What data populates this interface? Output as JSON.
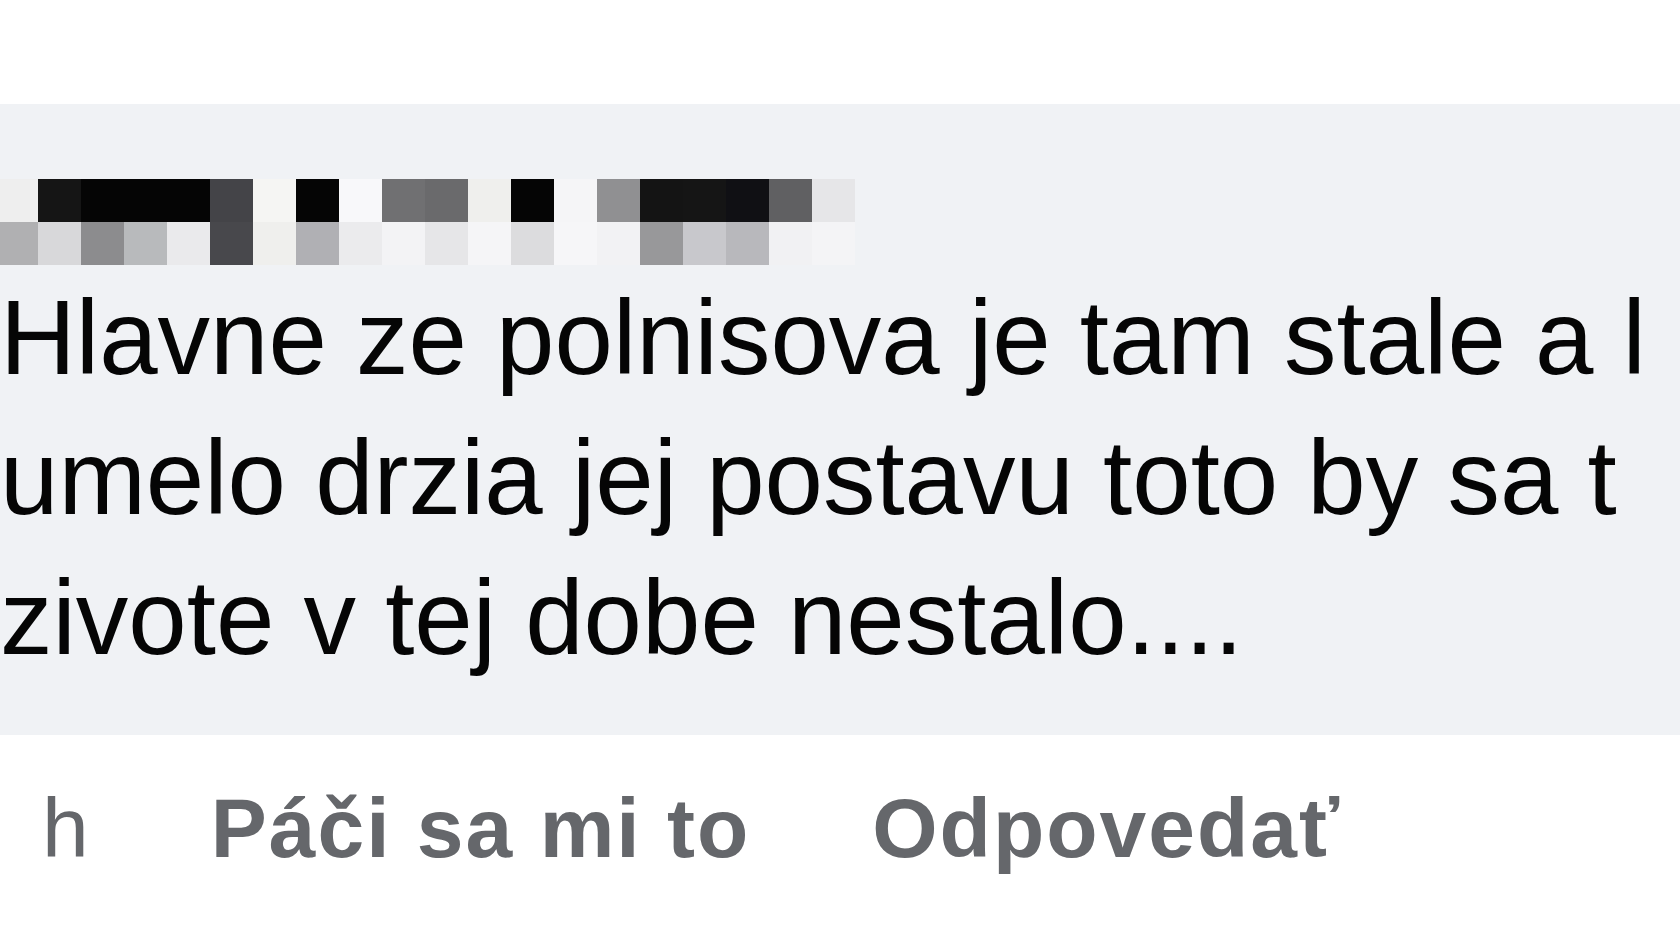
{
  "comment": {
    "lines": [
      "Hlavne ze polnisova je tam stale a l",
      "umelo drzia jej postavu toto by sa t",
      "zivote v tej dobe nestalo...."
    ]
  },
  "actions": [
    {
      "kind": "time",
      "label": "h"
    },
    {
      "kind": "link",
      "label": "Páči sa mi to"
    },
    {
      "kind": "link",
      "label": "Odpovedať"
    }
  ]
}
